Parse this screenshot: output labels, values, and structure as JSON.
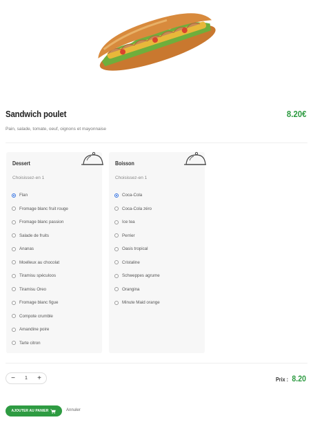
{
  "product": {
    "name": "Sandwich poulet",
    "price": "8.20€",
    "description": "Pain, salade, tomate, oeuf, oignons et mayonnaise"
  },
  "groups": [
    {
      "title": "Dessert",
      "subtitle": "Choisissez-en 1",
      "selected": 0,
      "options": [
        "Flan",
        "Fromage blanc fruit rouge",
        "Fromage blanc passion",
        "Salade de fruits",
        "Ananas",
        "Moelleux au chocolat",
        "Tiramisu spéculoos",
        "Tiramisu Oreo",
        "Fromage blanc figue",
        "Compote crumble",
        "Amandine poire",
        "Tarte citron"
      ]
    },
    {
      "title": "Boisson",
      "subtitle": "Choisissez-en 1",
      "selected": 0,
      "options": [
        "Coca-Cola",
        "Coca-Cola zéro",
        "Ice tea",
        "Perrier",
        "Oasis tropical",
        "Cristaline",
        "Schweppes agrume",
        "Orangina",
        "Minute Maid orange"
      ]
    }
  ],
  "footer": {
    "qty_minus": "−",
    "qty_value": "1",
    "qty_plus": "+",
    "prix_label": "Prix :",
    "prix_value": "8.20",
    "add_label": "AJOUTER AU PANIER",
    "cancel_label": "Annuler"
  },
  "colors": {
    "accent": "#2e9b42",
    "radio_selected": "#2f6ede"
  },
  "icons": {
    "hero": "sandwich-image",
    "card": "cloche-icon",
    "cart": "cart-icon"
  }
}
